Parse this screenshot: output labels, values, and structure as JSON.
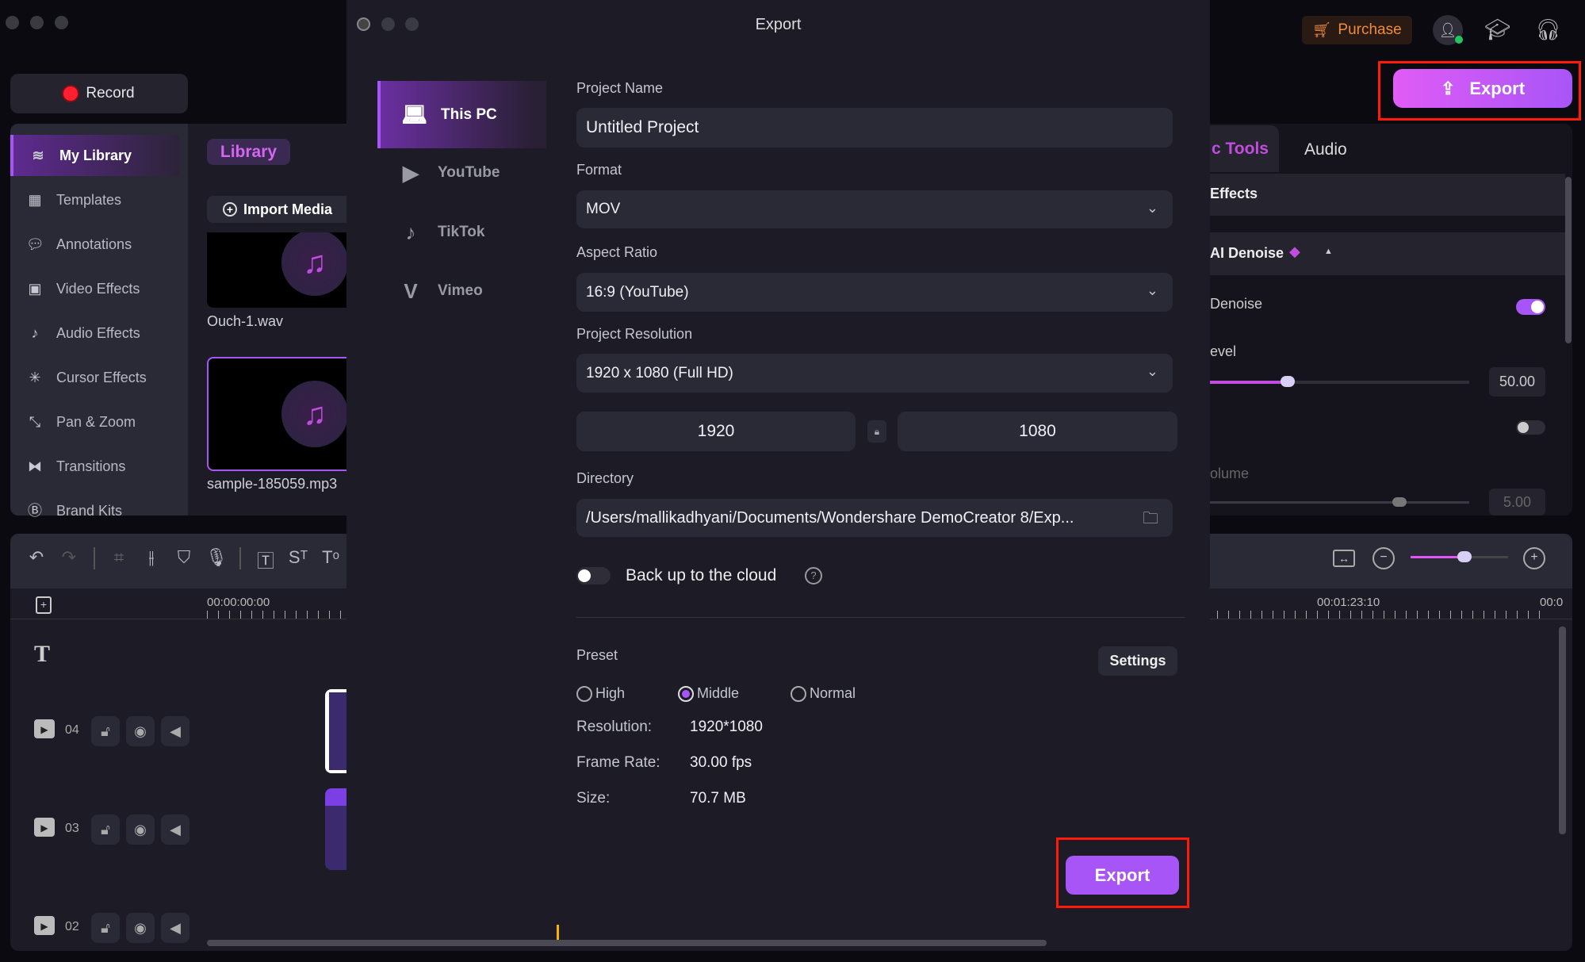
{
  "app": {
    "record_label": "Record",
    "purchase_label": "Purchase",
    "export_label": "Export",
    "accent": "#a855f7",
    "sidebar": {
      "items": [
        {
          "label": "My Library",
          "icon": "layers-icon",
          "active": true
        },
        {
          "label": "Templates",
          "icon": "templates-icon"
        },
        {
          "label": "Annotations",
          "icon": "annotation-icon"
        },
        {
          "label": "Video Effects",
          "icon": "video-effects-icon"
        },
        {
          "label": "Audio Effects",
          "icon": "audio-effects-icon"
        },
        {
          "label": "Cursor Effects",
          "icon": "cursor-effects-icon"
        },
        {
          "label": "Pan & Zoom",
          "icon": "pan-zoom-icon"
        },
        {
          "label": "Transitions",
          "icon": "transitions-icon"
        },
        {
          "label": "Brand Kits",
          "icon": "brand-kits-icon"
        }
      ]
    },
    "library": {
      "tab": "Library",
      "import_label": "Import Media",
      "media": [
        {
          "name": "Ouch-1.wav"
        },
        {
          "name": "sample-185059.mp3"
        }
      ]
    },
    "right_panel": {
      "tabs": [
        "c Tools",
        "Audio"
      ],
      "section": "Effects",
      "group": "AI Denoise",
      "denoise_label": "Denoise",
      "denoise_on": true,
      "level_label": "evel",
      "level_value": "50.00",
      "level_percent": 30,
      "toggle2_on": false,
      "volume_label": "olume",
      "volume_value": "5.00",
      "volume_percent": 73
    },
    "timeline": {
      "timecodes": [
        "00:00:00:00",
        "00:01:23:10",
        "00:0"
      ],
      "tracks": [
        {
          "num": "04"
        },
        {
          "num": "03"
        },
        {
          "num": "02"
        }
      ],
      "zoom_percent": 55
    }
  },
  "dialog": {
    "title": "Export",
    "nav": [
      {
        "label": "This PC",
        "icon": "laptop-icon",
        "active": true
      },
      {
        "label": "YouTube",
        "icon": "youtube-icon"
      },
      {
        "label": "TikTok",
        "icon": "tiktok-icon"
      },
      {
        "label": "Vimeo",
        "icon": "vimeo-icon"
      }
    ],
    "project_name_label": "Project Name",
    "project_name": "Untitled Project",
    "format_label": "Format",
    "format": "MOV",
    "aspect_label": "Aspect Ratio",
    "aspect": "16:9 (YouTube)",
    "resolution_label": "Project Resolution",
    "resolution": "1920 x 1080 (Full HD)",
    "width": "1920",
    "height": "1080",
    "directory_label": "Directory",
    "directory": "/Users/mallikadhyani/Documents/Wondershare DemoCreator 8/Exp...",
    "backup_label": "Back up to the cloud",
    "backup_on": false,
    "preset_label": "Preset",
    "settings_label": "Settings",
    "presets": [
      {
        "label": "High",
        "selected": false
      },
      {
        "label": "Middle",
        "selected": true
      },
      {
        "label": "Normal",
        "selected": false
      }
    ],
    "info": [
      {
        "label": "Resolution:",
        "value": "1920*1080"
      },
      {
        "label": "Frame Rate:",
        "value": "30.00 fps"
      },
      {
        "label": "Size:",
        "value": "70.7 MB"
      }
    ],
    "export_label": "Export"
  }
}
